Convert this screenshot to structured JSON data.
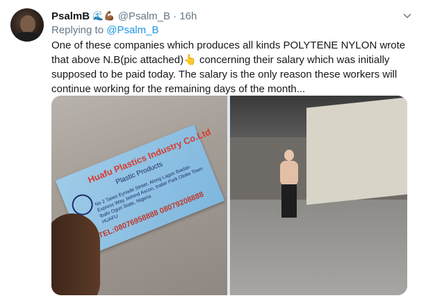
{
  "tweet": {
    "display_name": "PsalmB",
    "name_emojis": "🌊💪🏾",
    "handle": "@Psalm_B",
    "separator": "·",
    "time": "16h",
    "replying_prefix": "Replying to",
    "replying_handle": "@Psalm_B",
    "text": "One of these companies which produces all kinds POLYTENE NYLON wrote that above N.B(pic attached)👆 concerning their salary which was initially supposed to be paid today. The salary is the only reason these workers will continue working for the remaining days of the month..."
  },
  "photos": {
    "card": {
      "company": "Huafu Plastics Industry Co.Ltd",
      "products": "Plastic Products",
      "address_line1": "No 2 Taiwo Eynade Street, Along Lagos Ibadan",
      "address_line2": "Express Way, behind Ascon, trailer Park Oloke Town",
      "address_line3": "Ibafo Ogun State, Nigeria",
      "logo_text": "HUAFU",
      "tel": "TEL:08076958888 08079208888"
    }
  },
  "icons": {
    "more": "chevron-down-icon"
  },
  "colors": {
    "link": "#1b95e0",
    "muted": "#657786",
    "text": "#14171a"
  }
}
